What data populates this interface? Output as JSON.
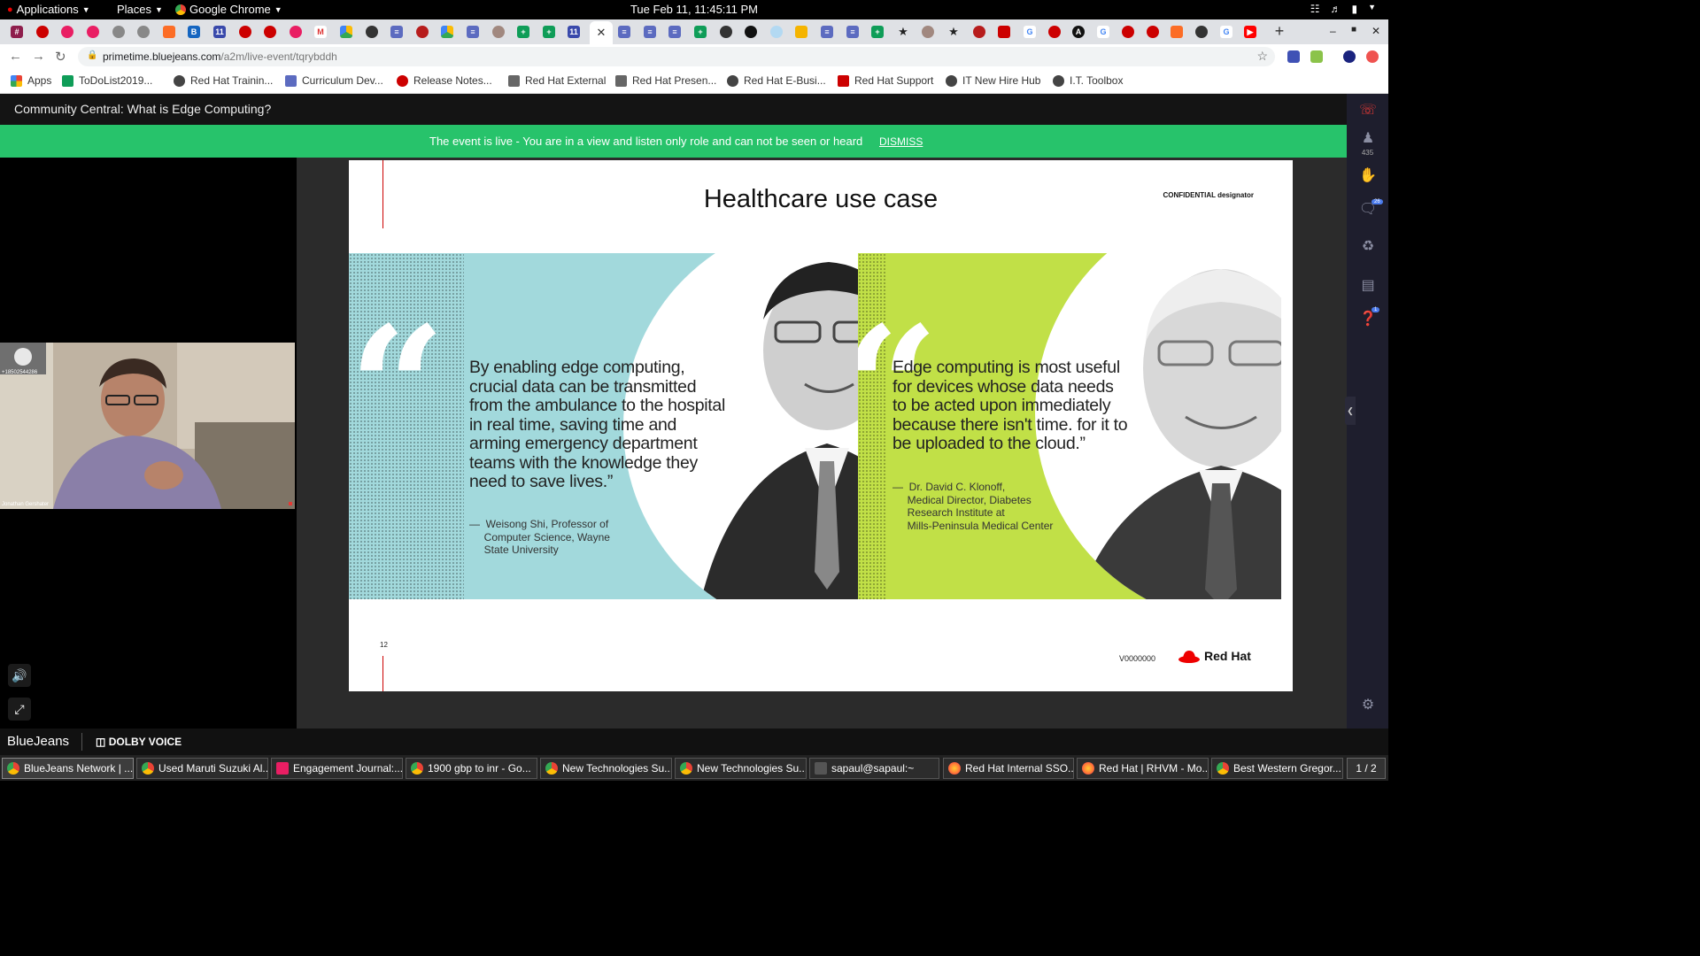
{
  "topbar": {
    "applications": "Applications",
    "places": "Places",
    "browser": "Google Chrome",
    "clock": "Tue Feb 11, 11:45:11 PM"
  },
  "address": {
    "host": "primetime.bluejeans.com",
    "path": "/a2m/live-event/tqrybddh"
  },
  "bookmarks": [
    {
      "label": "Apps",
      "color": "#e94235"
    },
    {
      "label": "ToDoList2019...",
      "color": "#0f9d58"
    },
    {
      "label": "Red Hat Trainin...",
      "color": "#444444"
    },
    {
      "label": "Curriculum Dev...",
      "color": "#5c6bc0"
    },
    {
      "label": "Release Notes...",
      "color": "#cc0000"
    },
    {
      "label": "Red Hat External",
      "color": "#666666"
    },
    {
      "label": "Red Hat Presen...",
      "color": "#666666"
    },
    {
      "label": "Red Hat E-Busi...",
      "color": "#444444"
    },
    {
      "label": "Red Hat Support",
      "color": "#cc0000"
    },
    {
      "label": "IT New Hire Hub",
      "color": "#444444"
    },
    {
      "label": "I.T. Toolbox",
      "color": "#444444"
    }
  ],
  "event": {
    "title": "Community Central: What is Edge Computing?",
    "banner_message": "The event is live - You are in a view and listen only role and can not be seen or heard",
    "dismiss": "DISMISS",
    "attendee_count": "435",
    "chat_badge": "26",
    "qa_badge": "1"
  },
  "slide": {
    "title": "Healthcare use case",
    "confidential": "CONFIDENTIAL designator",
    "page_number": "12",
    "code": "V0000000",
    "logo_text": "Red Hat",
    "quote_left": "By enabling edge computing, crucial data can be transmitted from the ambulance to the hospital in real time, saving time and arming emergency department teams with the knowledge they need to save lives.”",
    "attrib_left": "—  Weisong Shi, Professor of\n     Computer Science, Wayne\n     State University",
    "quote_right": "Edge computing is most useful for devices whose data needs to be acted upon immediately because there isn't time. for it to be uploaded to the cloud.”",
    "attrib_right": "—  Dr. David C. Klonoff,\n     Medical Director, Diabetes\n     Research Institute at\n     Mills-Peninsula Medical Center",
    "panel_left_color": "#a2d9dc",
    "panel_right_color": "#c1e047"
  },
  "webcam": {
    "participant_name": "Jonathan Gershater",
    "caller_id": "+18502544286"
  },
  "footer": {
    "brand": "BlueJeans",
    "dolby": "DOLBY VOICE"
  },
  "taskbar": {
    "items": [
      {
        "label": "BlueJeans Network | ...",
        "icon_color": "#4285f4"
      },
      {
        "label": "Used Maruti Suzuki Al...",
        "icon_color": "#4285f4"
      },
      {
        "label": "Engagement Journal:...",
        "icon_color": "#e91e63"
      },
      {
        "label": "1900 gbp to inr - Go...",
        "icon_color": "#4285f4"
      },
      {
        "label": "New Technologies Su...",
        "icon_color": "#4285f4"
      },
      {
        "label": "New Technologies Su...",
        "icon_color": "#4285f4"
      },
      {
        "label": "sapaul@sapaul:~",
        "icon_color": "#555555"
      },
      {
        "label": "Red Hat Internal SSO...",
        "icon_color": "#ff7139"
      },
      {
        "label": "Red Hat | RHVM - Mo...",
        "icon_color": "#ff7139"
      },
      {
        "label": "Best Western Gregor...",
        "icon_color": "#4285f4"
      }
    ],
    "workspace": "1 / 2"
  },
  "colors": {
    "banner": "#27c36b",
    "redhat_red": "#ee0000",
    "rail_bg": "#1e1e2d"
  }
}
